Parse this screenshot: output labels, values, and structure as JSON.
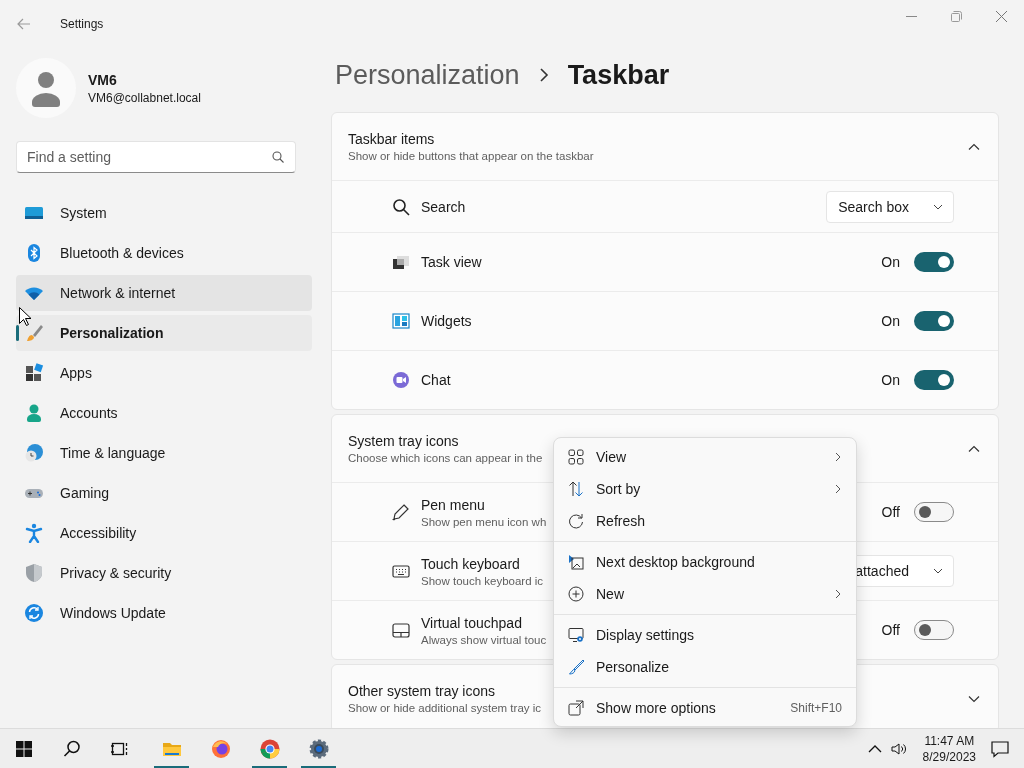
{
  "window": {
    "title": "Settings"
  },
  "user": {
    "name": "VM6",
    "email": "VM6@collabnet.local"
  },
  "search": {
    "placeholder": "Find a setting"
  },
  "sidebar": {
    "items": [
      {
        "label": "System",
        "selected": false,
        "hovered": false
      },
      {
        "label": "Bluetooth & devices",
        "selected": false,
        "hovered": false
      },
      {
        "label": "Network & internet",
        "selected": false,
        "hovered": true
      },
      {
        "label": "Personalization",
        "selected": true,
        "hovered": false
      },
      {
        "label": "Apps",
        "selected": false,
        "hovered": false
      },
      {
        "label": "Accounts",
        "selected": false,
        "hovered": false
      },
      {
        "label": "Time & language",
        "selected": false,
        "hovered": false
      },
      {
        "label": "Gaming",
        "selected": false,
        "hovered": false
      },
      {
        "label": "Accessibility",
        "selected": false,
        "hovered": false
      },
      {
        "label": "Privacy & security",
        "selected": false,
        "hovered": false
      },
      {
        "label": "Windows Update",
        "selected": false,
        "hovered": false
      }
    ]
  },
  "breadcrumb": {
    "parent": "Personalization",
    "current": "Taskbar"
  },
  "sections": [
    {
      "title": "Taskbar items",
      "subtitle": "Show or hide buttons that appear on the taskbar",
      "expanded": true,
      "rows": [
        {
          "kind": "dropdown",
          "label": "Search",
          "value": "Search box"
        },
        {
          "kind": "toggle",
          "label": "Task view",
          "on": true,
          "state_label": "On"
        },
        {
          "kind": "toggle",
          "label": "Widgets",
          "on": true,
          "state_label": "On"
        },
        {
          "kind": "toggle",
          "label": "Chat",
          "on": true,
          "state_label": "On"
        }
      ]
    },
    {
      "title": "System tray icons",
      "subtitle": "Choose which icons can appear in the",
      "expanded": true,
      "rows": [
        {
          "kind": "toggle",
          "label": "Pen menu",
          "description": "Show pen menu icon wh",
          "on": false,
          "state_label": "Off"
        },
        {
          "kind": "dropdown",
          "label": "Touch keyboard",
          "description": "Show touch keyboard ic",
          "value": "attached"
        },
        {
          "kind": "toggle",
          "label": "Virtual touchpad",
          "description": "Always show virtual touc",
          "on": false,
          "state_label": "Off"
        }
      ]
    },
    {
      "title": "Other system tray icons",
      "subtitle": "Show or hide additional system tray ic",
      "expanded": false
    }
  ],
  "context_menu": {
    "groups": [
      [
        {
          "label": "View",
          "submenu": true
        },
        {
          "label": "Sort by",
          "submenu": true
        },
        {
          "label": "Refresh",
          "submenu": false
        }
      ],
      [
        {
          "label": "Next desktop background",
          "submenu": false
        },
        {
          "label": "New",
          "submenu": true
        }
      ],
      [
        {
          "label": "Display settings",
          "submenu": false
        },
        {
          "label": "Personalize",
          "submenu": false
        }
      ],
      [
        {
          "label": "Show more options",
          "submenu": false,
          "shortcut": "Shift+F10"
        }
      ]
    ]
  },
  "taskbar": {
    "apps": [
      {
        "running": true
      },
      {
        "running": false
      },
      {
        "running": true
      },
      {
        "running": true
      }
    ]
  },
  "clock": {
    "time": "11:47 AM",
    "date": "8/29/2023"
  }
}
